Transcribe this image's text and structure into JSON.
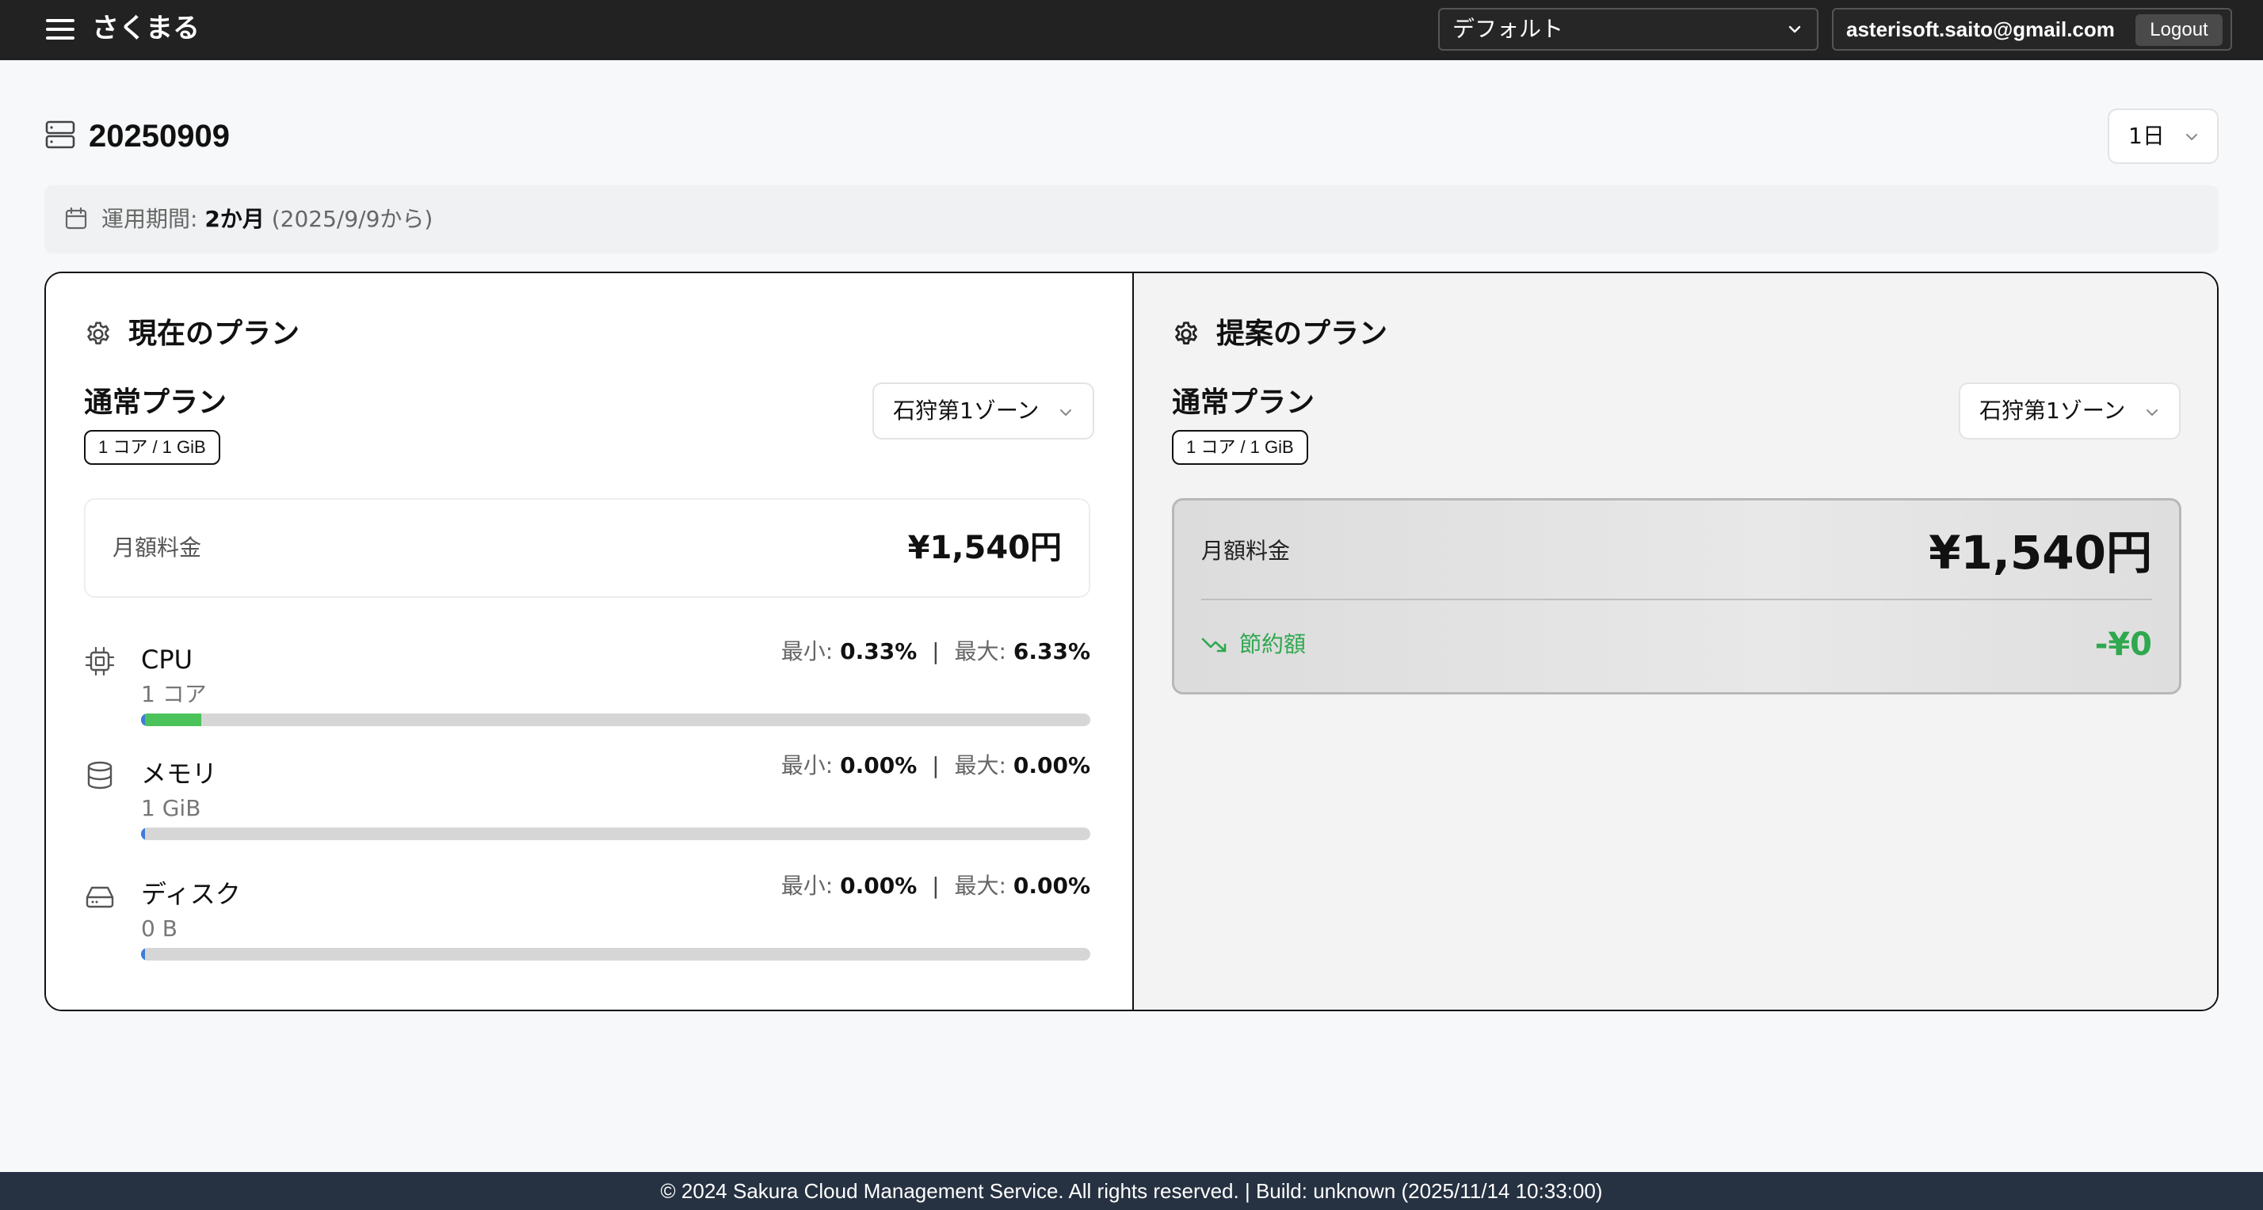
{
  "app": {
    "brand": "さくまる"
  },
  "navbar": {
    "project_selected": "デフォルト",
    "user_email": "asterisoft.saito@gmail.com",
    "logout_label": "Logout"
  },
  "page": {
    "title": "20250909",
    "period_selected": "1日"
  },
  "info": {
    "label": "運用期間:",
    "duration": "2か月",
    "since": "(2025/9/9から)"
  },
  "current_plan": {
    "heading": "現在のプラン",
    "plan_name": "通常プラン",
    "spec": "1 コア / 1 GiB",
    "zone": "石狩第1ゾーン",
    "monthly_label": "月額料金",
    "monthly_value": "¥1,540円"
  },
  "metrics": {
    "min_label": "最小:",
    "max_label": "最大:",
    "separator": "|",
    "cpu": {
      "name": "CPU",
      "sub": "1 コア",
      "min": "0.33%",
      "max": "6.33%",
      "fill_percent": 6.33,
      "icon": "cpu-icon"
    },
    "memory": {
      "name": "メモリ",
      "sub": "1 GiB",
      "min": "0.00%",
      "max": "0.00%",
      "fill_percent": 0,
      "icon": "database-icon"
    },
    "disk": {
      "name": "ディスク",
      "sub": "0 B",
      "min": "0.00%",
      "max": "0.00%",
      "fill_percent": 0,
      "icon": "hard-drive-icon"
    }
  },
  "proposed_plan": {
    "heading": "提案のプラン",
    "plan_name": "通常プラン",
    "spec": "1 コア / 1 GiB",
    "zone": "石狩第1ゾーン",
    "monthly_label": "月額料金",
    "monthly_value": "¥1,540円",
    "savings_label": "節約額",
    "savings_value": "-¥0"
  },
  "colors": {
    "navbar": "#222222",
    "footer": "#263141",
    "savings_green": "#2fa84f",
    "bar_fill": "#4cc35a",
    "bar_start": "#3d7bd8"
  },
  "footer": {
    "text": "© 2024 Sakura Cloud Management Service. All rights reserved. | Build: unknown (2025/11/14 10:33:00)"
  }
}
